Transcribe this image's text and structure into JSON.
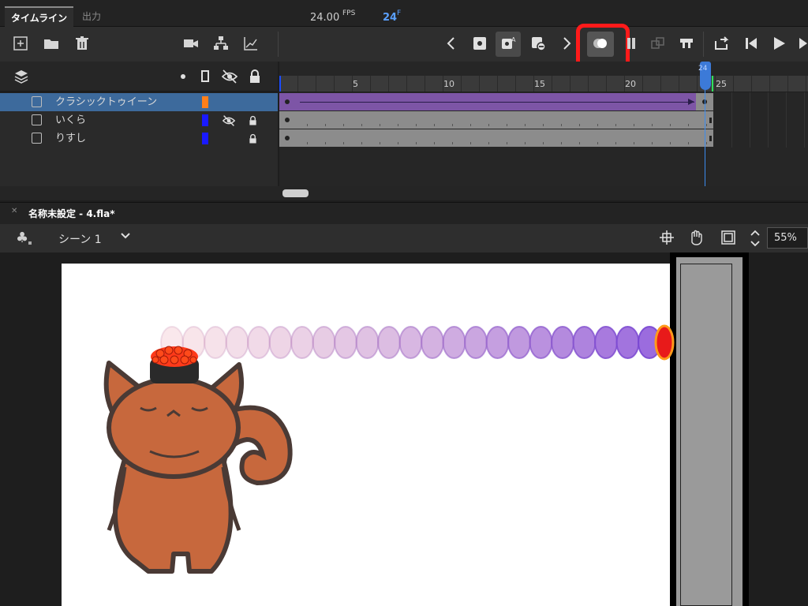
{
  "panel_tabs": {
    "timeline": "タイムライン",
    "output": "出力"
  },
  "toolbar": {
    "fps_value": "24.00",
    "fps_unit": "FPS",
    "frame_value": "24",
    "frame_unit": "F",
    "icons": [
      "new-layer-icon",
      "new-folder-icon",
      "delete-icon",
      "camera-icon",
      "layer-parenting-icon",
      "graph-icon",
      "prev-keyframe-icon",
      "insert-keyframe-icon",
      "auto-keyframe-icon",
      "blank-keyframe-icon",
      "next-keyframe-icon",
      "onion-skin-icon",
      "edit-multiple-frames-icon",
      "paste-icon",
      "loop-icon",
      "first-frame-icon",
      "step-back-icon",
      "play-icon",
      "step-forward-icon"
    ]
  },
  "ruler": {
    "labels": [
      "5",
      "10",
      "15",
      "20",
      "25"
    ],
    "playhead_frame": "24"
  },
  "layers": [
    {
      "name": "クラシックトゥイーン",
      "color": "#ff7f1a",
      "selected": true,
      "hidden": false,
      "locked": false
    },
    {
      "name": "いくら",
      "color": "#1a1aff",
      "selected": false,
      "hidden": true,
      "locked": true
    },
    {
      "name": "りすし",
      "color": "#1a1aff",
      "selected": false,
      "hidden": false,
      "locked": true
    }
  ],
  "document": {
    "title": "名称未設定 - 4.fla*"
  },
  "scene": {
    "label": "シーン 1"
  },
  "zoom": "55%",
  "colors": {
    "tween": "#7d55a6",
    "highlight": "#ff1a1a",
    "playhead": "#3c8cf0"
  }
}
